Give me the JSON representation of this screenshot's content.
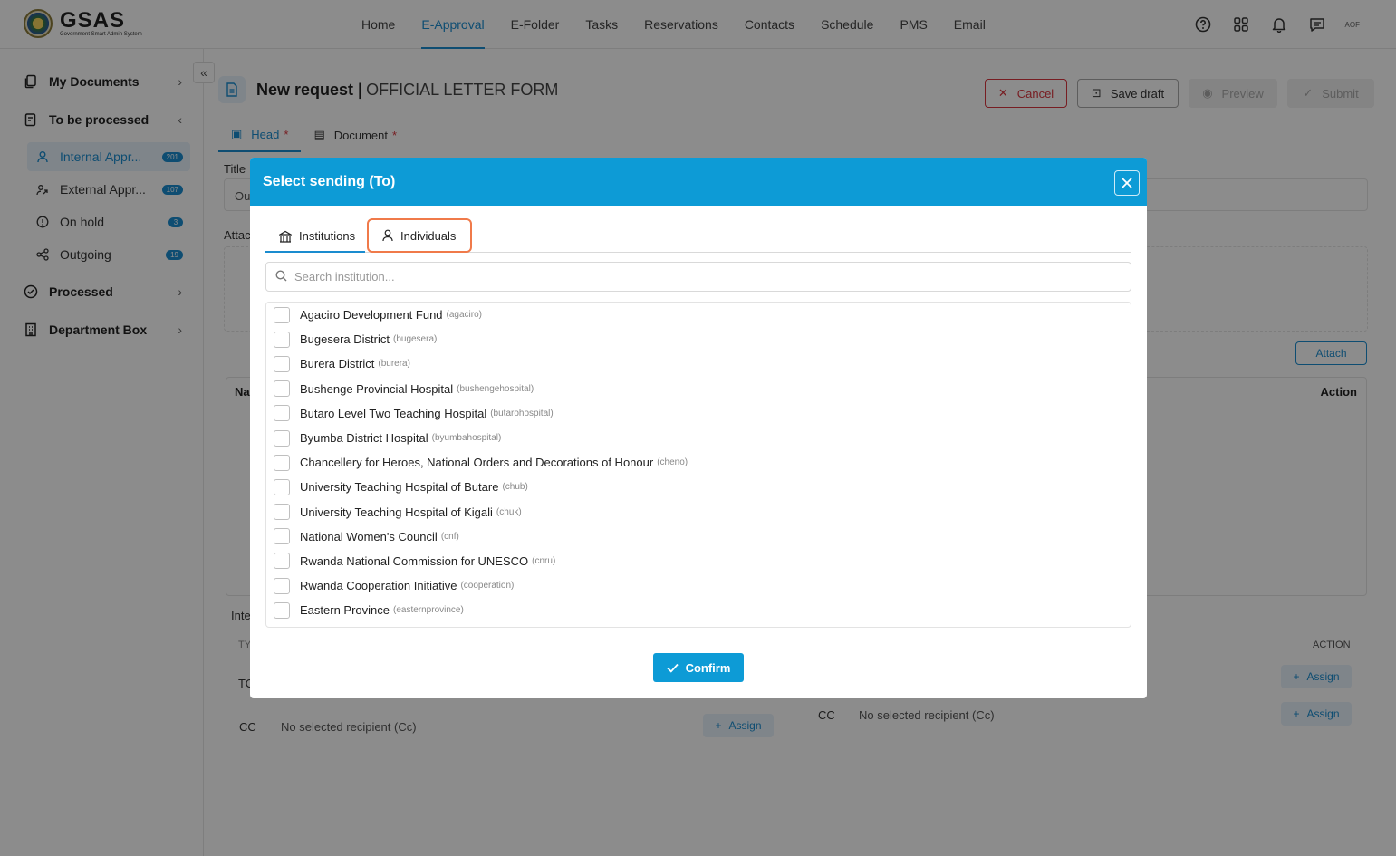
{
  "app": {
    "logo_title": "GSAS",
    "logo_subtitle": "Government Smart Admin System",
    "user_initials": "AOF"
  },
  "nav": {
    "items": [
      "Home",
      "E-Approval",
      "E-Folder",
      "Tasks",
      "Reservations",
      "Contacts",
      "Schedule",
      "PMS",
      "Email"
    ],
    "active": "E-Approval"
  },
  "sidebar": {
    "my_documents": "My Documents",
    "to_be_processed": "To be processed",
    "sub_items": [
      {
        "label": "Internal Appr...",
        "badge": "201"
      },
      {
        "label": "External Appr...",
        "badge": "107"
      },
      {
        "label": "On hold",
        "badge": "3"
      },
      {
        "label": "Outgoing",
        "badge": "19"
      }
    ],
    "processed": "Processed",
    "department_box": "Department Box"
  },
  "page": {
    "title": "New request |",
    "subtitle": "OFFICIAL LETTER FORM",
    "cancel": "Cancel",
    "save_draft": "Save draft",
    "preview": "Preview",
    "submit": "Submit",
    "tab_head": "Head",
    "tab_document": "Document",
    "req_mark": "*",
    "title_label": "Title",
    "title_value_partial": "Ou",
    "attach_label": "Attac",
    "attach_button": "Attach",
    "table_col_name": "Na",
    "table_col_action": "Action",
    "internal_label": "Inte",
    "type_col": "TY",
    "action_col": "ACTION",
    "to_row": "TO",
    "cc_row": "CC",
    "no_recipient_cc": "No selected recipient (Cc)",
    "assign": "Assign"
  },
  "modal": {
    "title": "Select sending (To)",
    "tab_institutions": "Institutions",
    "tab_individuals": "Individuals",
    "search_placeholder": "Search institution...",
    "confirm": "Confirm",
    "items": [
      {
        "name": "Agaciro Development Fund",
        "code": "(agaciro)"
      },
      {
        "name": "Bugesera District",
        "code": "(bugesera)"
      },
      {
        "name": "Burera District",
        "code": "(burera)"
      },
      {
        "name": "Bushenge Provincial Hospital",
        "code": "(bushengehospital)"
      },
      {
        "name": "Butaro Level Two Teaching Hospital",
        "code": "(butarohospital)"
      },
      {
        "name": "Byumba District Hospital",
        "code": "(byumbahospital)"
      },
      {
        "name": "Chancellery for Heroes, National Orders and Decorations of Honour",
        "code": "(cheno)"
      },
      {
        "name": "University Teaching Hospital of Butare",
        "code": "(chub)"
      },
      {
        "name": "University Teaching Hospital of Kigali",
        "code": "(chuk)"
      },
      {
        "name": "National Women's Council",
        "code": "(cnf)"
      },
      {
        "name": "Rwanda National Commission for UNESCO",
        "code": "(cnru)"
      },
      {
        "name": "Rwanda Cooperation Initiative",
        "code": "(cooperation)"
      },
      {
        "name": "Eastern Province",
        "code": "(easternprovince)"
      }
    ]
  },
  "colors": {
    "accent": "#1a8ccf",
    "modal_header": "#0d9bd6",
    "highlight": "#f07a4a",
    "danger": "#d9363e"
  }
}
